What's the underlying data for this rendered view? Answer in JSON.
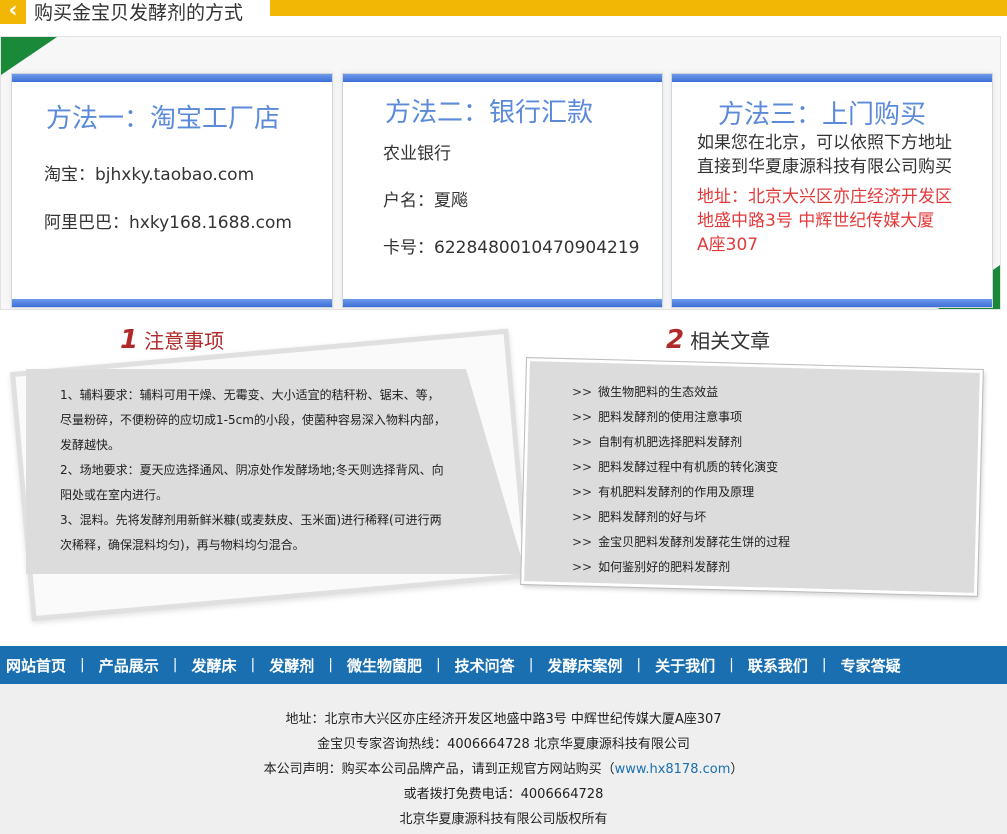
{
  "header": {
    "title": "购买金宝贝发酵剂的方式",
    "back_icon": "‹"
  },
  "methods": [
    {
      "title": "方法一：淘宝工厂店",
      "lines": [
        "淘宝：bjhxky.taobao.com",
        "阿里巴巴：hxky168.1688.com"
      ]
    },
    {
      "title": "方法二：银行汇款",
      "lines": [
        "农业银行",
        "户名：夏飚",
        "卡号：6228480010470904219"
      ]
    },
    {
      "title": "方法三：上门购买",
      "lines": [
        "如果您在北京，可以依照下方地址",
        "直接到华夏康源科技有限公司购买"
      ],
      "address": [
        "地址：北京大兴区亦庄经济开发区",
        "地盛中路3号 中辉世纪传媒大厦",
        "A座307"
      ]
    }
  ],
  "notes": {
    "number": "1",
    "title": "注意事项",
    "items": [
      "1、辅料要求：辅料可用干燥、无霉变、大小适宜的秸秆粉、锯末、等，尽量粉碎，不便粉碎的应切成1-5cm的小段，使菌种容易深入物料内部，发酵越快。",
      "2、场地要求：夏天应选择通风、阴凉处作发酵场地;冬天则选择背风、向阳处或在室内进行。",
      "3、混料。先将发酵剂用新鲜米糠(或麦麸皮、玉米面)进行稀释(可进行两次稀释，确保混料均匀)，再与物料均匀混合。"
    ]
  },
  "articles": {
    "number": "2",
    "title": "相关文章",
    "arrow": ">>",
    "items": [
      "微生物肥料的生态效益",
      "肥料发酵剂的使用注意事项",
      "自制有机肥选择肥料发酵剂",
      "肥料发酵过程中有机质的转化演变",
      "有机肥料发酵剂的作用及原理",
      "肥料发酵剂的好与坏",
      "金宝贝肥料发酵剂发酵花生饼的过程",
      "如何鉴别好的肥料发酵剂"
    ]
  },
  "nav": {
    "separator": "|",
    "items": [
      "网站首页",
      "产品展示",
      "发酵床",
      "发酵剂",
      "微生物菌肥",
      "技术问答",
      "发酵床案例",
      "关于我们",
      "联系我们",
      "专家答疑"
    ]
  },
  "footer": {
    "address": "地址：北京市大兴区亦庄经济开发区地盛中路3号 中辉世纪传媒大厦A座307",
    "hotline": "金宝贝专家咨询热线：4006664728 北京华夏康源科技有限公司",
    "notice_prefix": "本公司声明：购买本公司品牌产品，请到正规官方网站购买（",
    "notice_link": "www.hx8178.com",
    "notice_suffix": "）",
    "phone": "或者拨打免费电话：4006664728",
    "copyright": "北京华夏康源科技有限公司版权所有"
  },
  "colors": {
    "accent": "#f2b705",
    "nav": "#1a6fb0",
    "green": "#1a8a3a",
    "card_blue": "#5b8ad9",
    "address_red": "#e23a3a"
  }
}
